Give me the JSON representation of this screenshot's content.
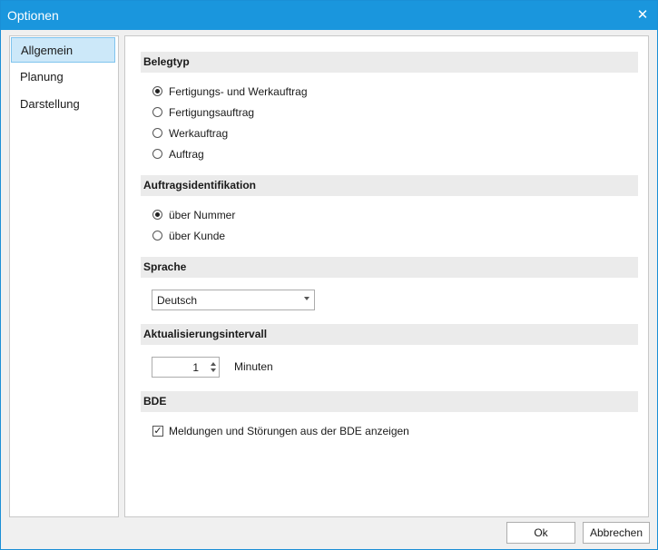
{
  "window": {
    "title": "Optionen",
    "close_glyph": "✕"
  },
  "nav": {
    "items": [
      {
        "label": "Allgemein",
        "selected": true
      },
      {
        "label": "Planung",
        "selected": false
      },
      {
        "label": "Darstellung",
        "selected": false
      }
    ]
  },
  "sections": {
    "belegtyp": {
      "title": "Belegtyp",
      "options": [
        {
          "label": "Fertigungs- und Werkauftrag",
          "checked": true
        },
        {
          "label": "Fertigungsauftrag",
          "checked": false
        },
        {
          "label": "Werkauftrag",
          "checked": false
        },
        {
          "label": "Auftrag",
          "checked": false
        }
      ]
    },
    "auftragsidentifikation": {
      "title": "Auftragsidentifikation",
      "options": [
        {
          "label": "über Nummer",
          "checked": true
        },
        {
          "label": "über Kunde",
          "checked": false
        }
      ]
    },
    "sprache": {
      "title": "Sprache",
      "selected": "Deutsch"
    },
    "aktualisierung": {
      "title": "Aktualisierungsintervall",
      "value": "1",
      "unit": "Minuten"
    },
    "bde": {
      "title": "BDE",
      "checkbox_label": "Meldungen und Störungen aus der BDE anzeigen",
      "checked": true,
      "check_glyph": "✓"
    }
  },
  "buttons": {
    "ok": "Ok",
    "cancel": "Abbrechen"
  },
  "colors": {
    "titlebar": "#1a96dd",
    "nav_selected": "#cce8f9",
    "section_header": "#ebebeb"
  }
}
